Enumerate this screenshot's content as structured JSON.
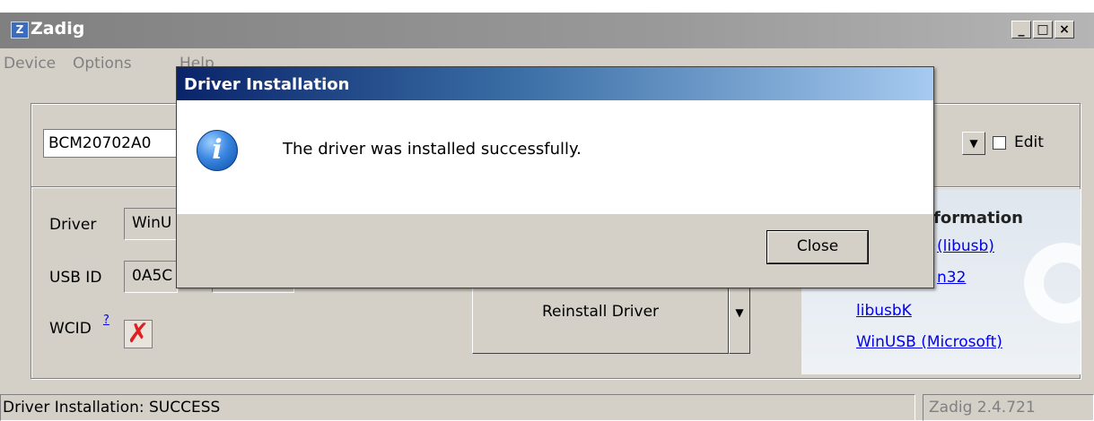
{
  "window": {
    "title": "Zadig",
    "app_icon": "Z",
    "caption_buttons": {
      "minimize": "_",
      "maximize": "□",
      "close": "×"
    }
  },
  "menu": [
    "Device",
    "Options",
    "Help"
  ],
  "device": {
    "selected": "BCM20702A0",
    "edit_label": "Edit"
  },
  "driver_section": {
    "driver_label": "Driver",
    "driver_value": "WinU",
    "usb_id_label": "USB ID",
    "usb_id_value": "0A5C",
    "wcid_label": "WCID",
    "wcid_link": "?",
    "wcid_status": "✗",
    "reinstall_button": "Reinstall Driver"
  },
  "info_panel": {
    "title": "formation",
    "links": [
      "(libusb)",
      "n32",
      "libusbK",
      "WinUSB (Microsoft)"
    ]
  },
  "status": {
    "message": "Driver Installation: SUCCESS",
    "version": "Zadig 2.4.721"
  },
  "dialog": {
    "title": "Driver Installation",
    "message": "The driver was installed successfully.",
    "icon": "info-icon",
    "icon_glyph": "i",
    "close_button": "Close"
  },
  "colors": {
    "window_bg": "#d4d0c8",
    "dialog_title_start": "#0a246a",
    "dialog_title_end": "#a6caf0",
    "link": "#0000ee",
    "wcid_x": "#e02020"
  }
}
